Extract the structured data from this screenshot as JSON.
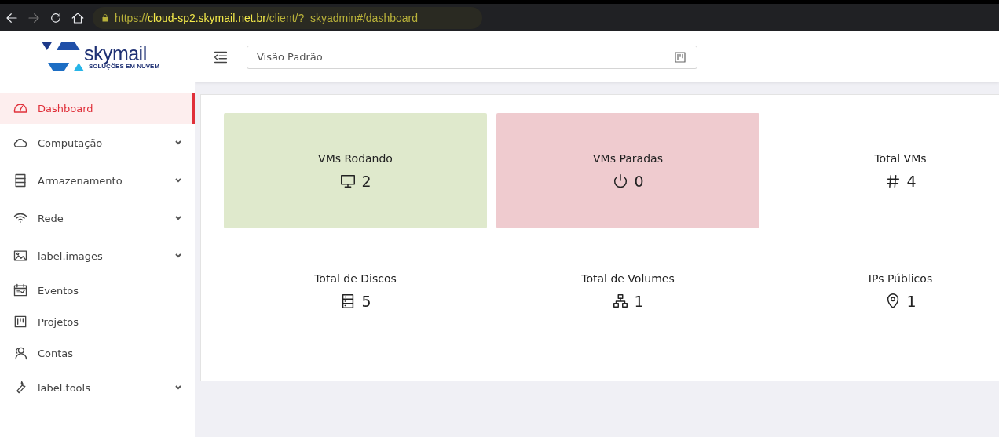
{
  "browser": {
    "url": {
      "scheme": "https://",
      "host": "cloud-sp2.skymail.net.br",
      "path": "/client/?_skyadmin#/dashboard"
    }
  },
  "logo": {
    "name": "skymail",
    "tagline": "SOLUÇÕES EM NUVEM"
  },
  "header": {
    "view_select": {
      "value": "Visão Padrão"
    }
  },
  "sidebar": {
    "items": [
      {
        "label": "Dashboard",
        "selected": true,
        "expandable": false
      },
      {
        "label": "Computação",
        "selected": false,
        "expandable": true
      },
      {
        "label": "Armazenamento",
        "selected": false,
        "expandable": true
      },
      {
        "label": "Rede",
        "selected": false,
        "expandable": true
      },
      {
        "label": "label.images",
        "selected": false,
        "expandable": true
      },
      {
        "label": "Eventos",
        "selected": false,
        "expandable": false
      },
      {
        "label": "Projetos",
        "selected": false,
        "expandable": false
      },
      {
        "label": "Contas",
        "selected": false,
        "expandable": false
      },
      {
        "label": "label.tools",
        "selected": false,
        "expandable": true
      }
    ]
  },
  "stats": [
    {
      "title": "VMs Rodando",
      "value": "2",
      "color": "#dfe9cc"
    },
    {
      "title": "VMs Paradas",
      "value": "0",
      "color": "#efcbcf"
    },
    {
      "title": "Total VMs",
      "value": "4"
    },
    {
      "title": "Total de Discos",
      "value": "5"
    },
    {
      "title": "Total de Volumes",
      "value": "1"
    },
    {
      "title": "IPs Públicos",
      "value": "1"
    }
  ]
}
